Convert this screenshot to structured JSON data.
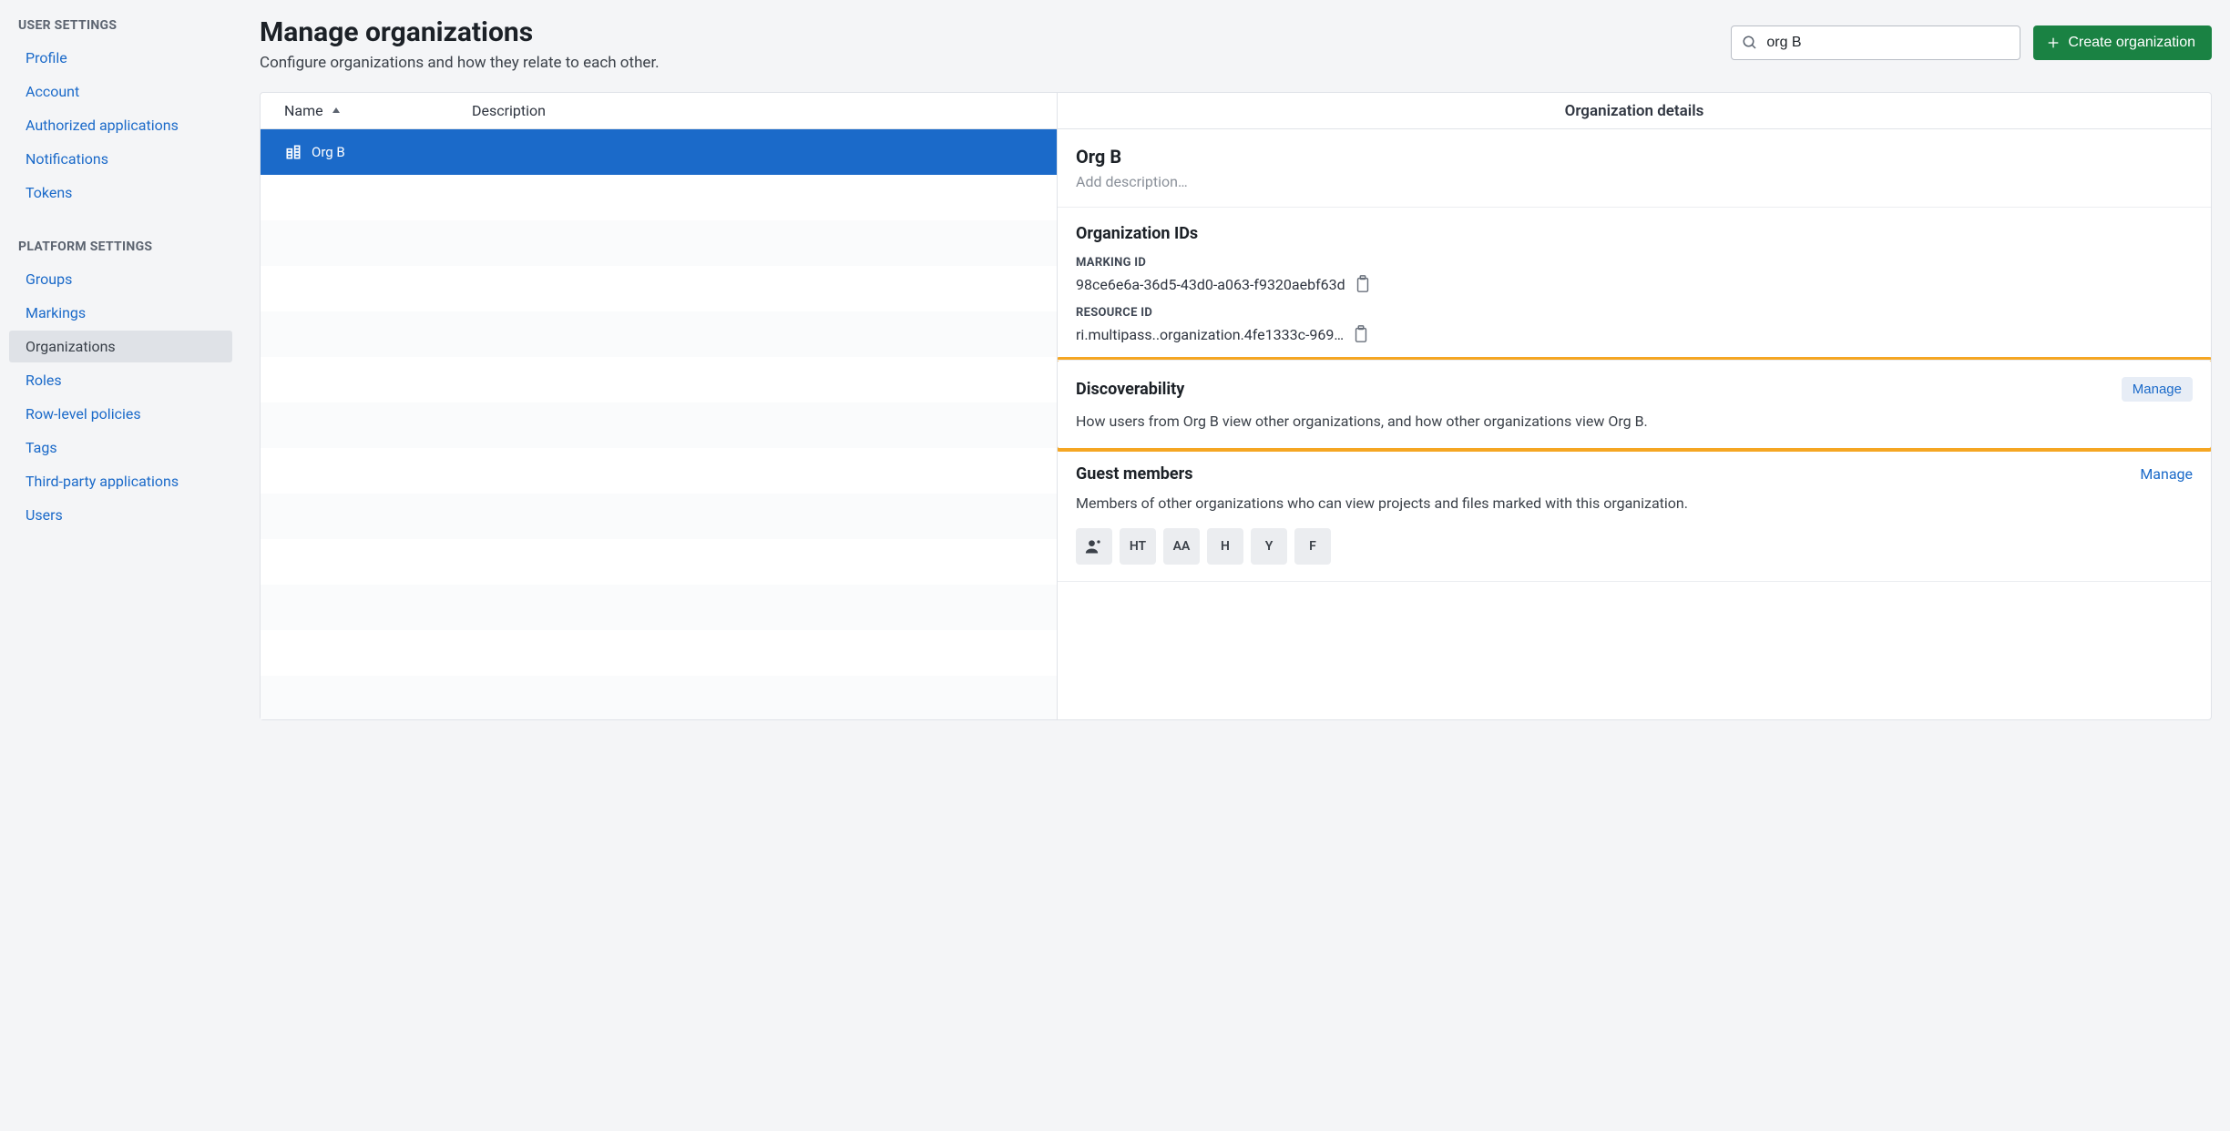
{
  "sidebar": {
    "section1_label": "USER SETTINGS",
    "section1_items": [
      "Profile",
      "Account",
      "Authorized applications",
      "Notifications",
      "Tokens"
    ],
    "section2_label": "PLATFORM SETTINGS",
    "section2_items": [
      "Groups",
      "Markings",
      "Organizations",
      "Roles",
      "Row-level policies",
      "Tags",
      "Third-party applications",
      "Users"
    ],
    "active_item": "Organizations"
  },
  "header": {
    "title": "Manage organizations",
    "subtitle": "Configure organizations and how they relate to each other.",
    "search_value": "org B",
    "create_label": "Create organization"
  },
  "table": {
    "col_name": "Name",
    "col_desc": "Description",
    "rows": [
      {
        "name": "Org B",
        "selected": true
      }
    ],
    "pad_rows": 12
  },
  "details": {
    "title": "Organization details",
    "org_name": "Org B",
    "desc_placeholder": "Add description…",
    "ids_title": "Organization IDs",
    "marking_label": "MARKING ID",
    "marking_id": "98ce6e6a-36d5-43d0-a063-f9320aebf63d",
    "resource_label": "RESOURCE ID",
    "resource_id": "ri.multipass..organization.4fe1333c-969…",
    "discoverability": {
      "title": "Discoverability",
      "manage": "Manage",
      "desc": "How users from Org B view other organizations, and how other organizations view Org B."
    },
    "guests": {
      "title": "Guest members",
      "manage": "Manage",
      "desc": "Members of other organizations who can view projects and files marked with this organization.",
      "badges": [
        "icon",
        "HT",
        "AA",
        "H",
        "Y",
        "F"
      ]
    }
  }
}
